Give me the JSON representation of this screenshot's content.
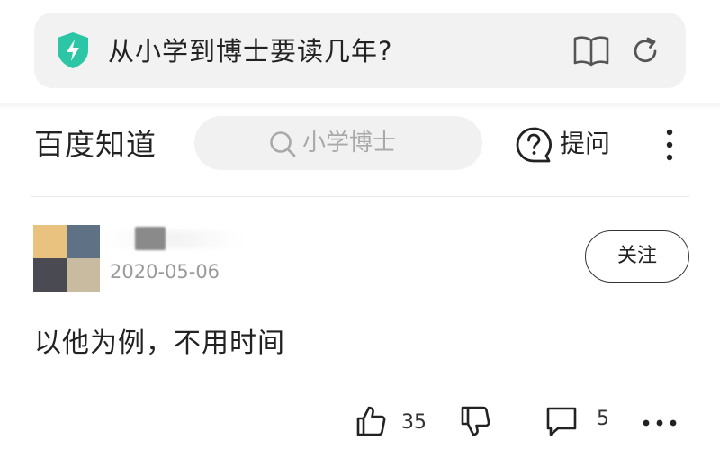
{
  "browser": {
    "url_title": "从小学到博士要读几年?",
    "icons": {
      "security": "shield-bolt-icon",
      "reader": "book-icon",
      "refresh": "refresh-icon"
    },
    "shield_color": "#2cc6a7"
  },
  "site": {
    "logo_text": "百度知道",
    "search_placeholder": "小学博士",
    "ask_label": "提问"
  },
  "answer": {
    "date": "2020-05-06",
    "follow_label": "关注",
    "text": "以他为例，不用时间",
    "avatar_colors": [
      "#e9c27f",
      "#5f7285",
      "#4a4a52",
      "#c9bb9f"
    ],
    "actions": {
      "like_count": "35",
      "comment_count": "5"
    }
  }
}
